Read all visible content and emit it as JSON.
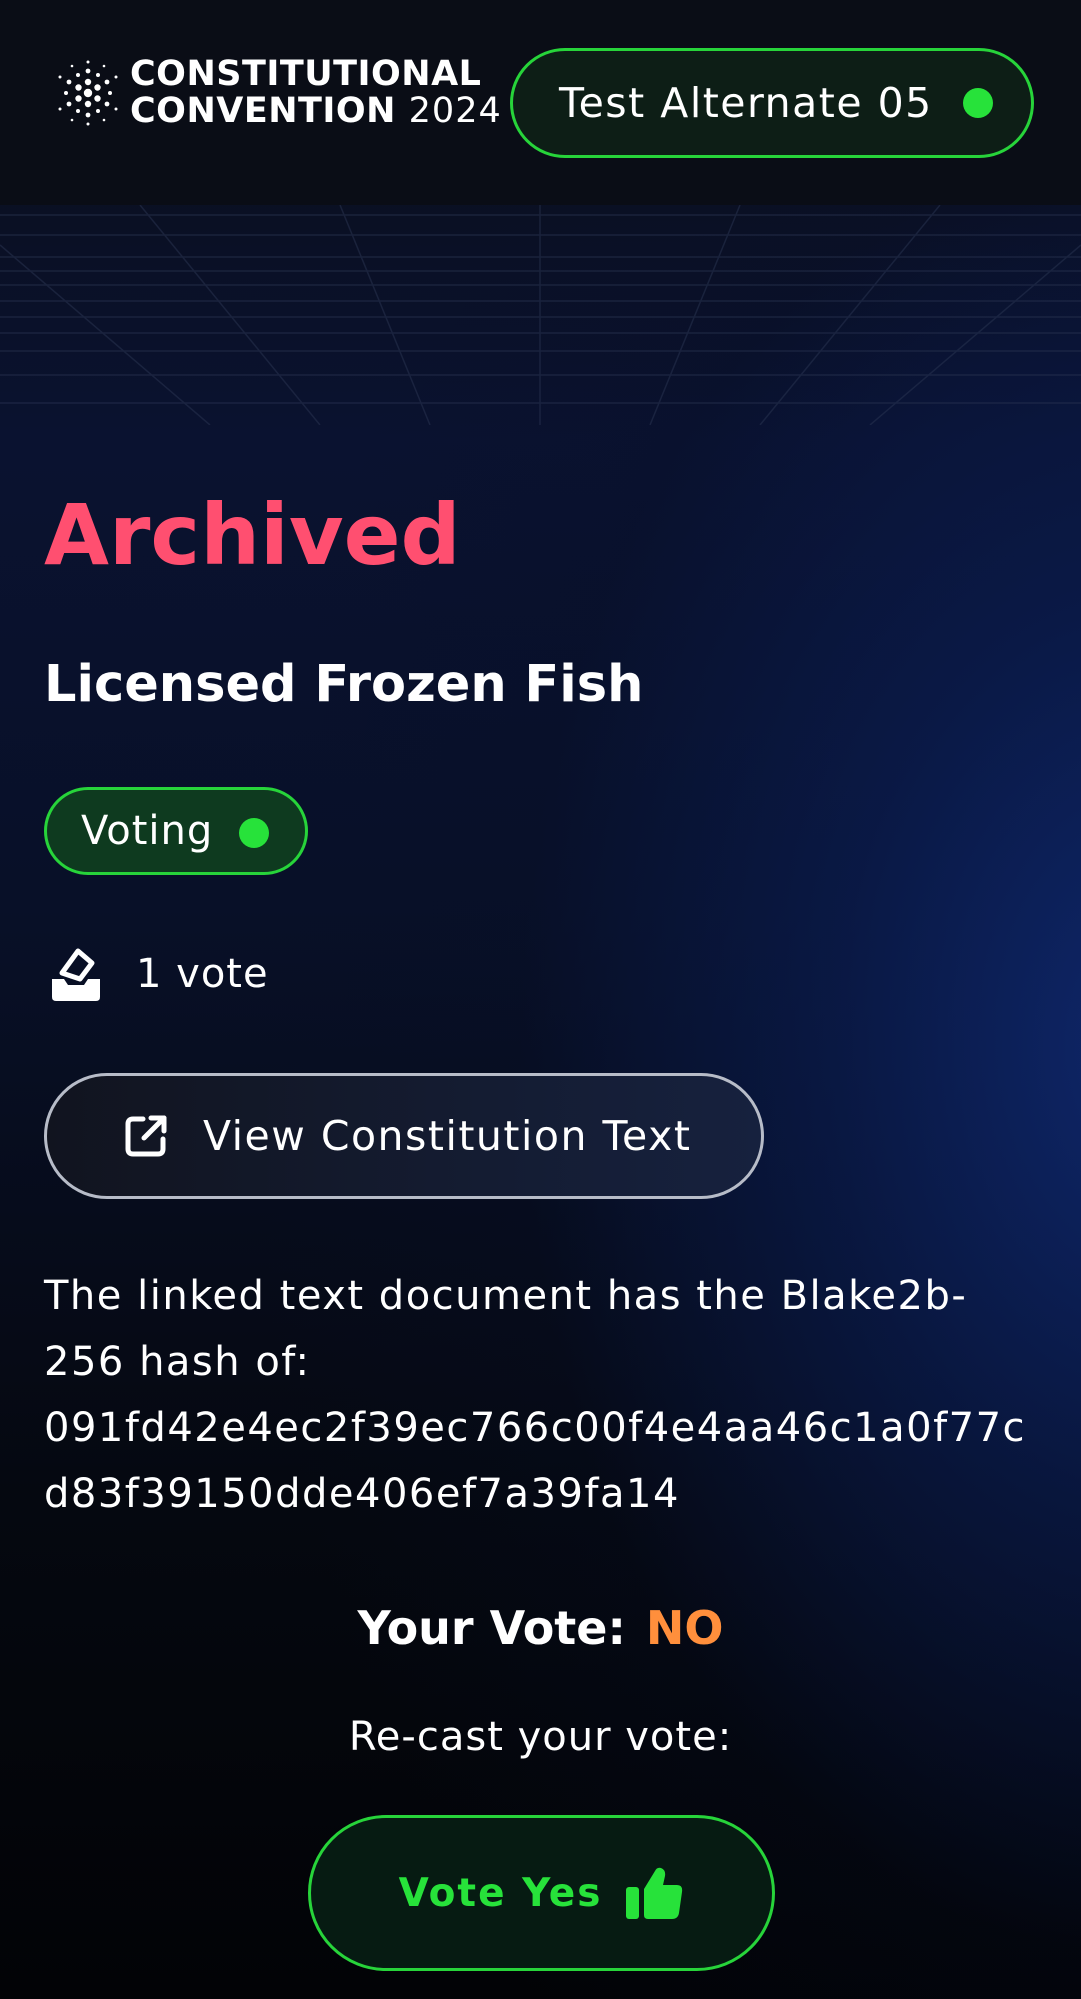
{
  "header": {
    "logo_line1": "CONSTITUTIONAL",
    "logo_line2": "CONVENTION",
    "logo_year": "2024",
    "user_name": "Test Alternate 05",
    "user_status_color": "#27e23a"
  },
  "proposal": {
    "status": "Archived",
    "title": "Licensed Frozen Fish",
    "phase_badge": "Voting",
    "vote_count": "1 vote",
    "view_button": "View Constitution Text",
    "hash_intro": "The linked text document has the Blake2b-256 hash of:",
    "hash_value": "091fd42e4ec2f39ec766c00f4e4aa46c1a0f77cd83f39150dde406ef7a39fa14"
  },
  "vote": {
    "label": "Your Vote:",
    "value": "NO",
    "recast_prompt": "Re-cast your vote:",
    "vote_yes_label": "Vote Yes"
  },
  "icons": {
    "logo": "cardano-logo-icon",
    "status": "online-dot-icon",
    "votes": "ballot-box-icon",
    "view": "external-link-icon",
    "vote_yes": "thumbs-up-icon"
  },
  "colors": {
    "archived": "#ff4f70",
    "accent_green": "#27e23a",
    "vote_no": "#ff8f3c"
  }
}
